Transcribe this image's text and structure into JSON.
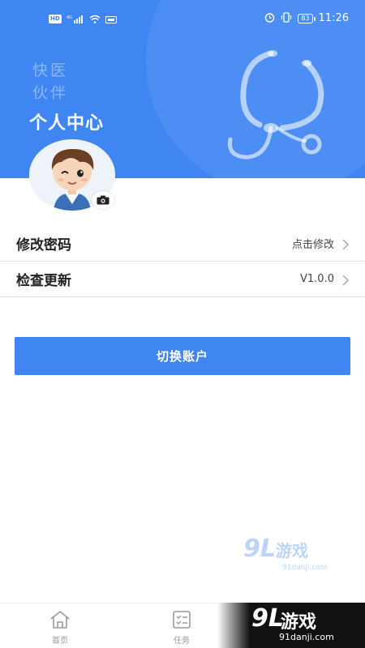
{
  "status_bar": {
    "hd": "HD",
    "network": "4G",
    "battery": "83",
    "time": "11:26"
  },
  "header": {
    "logo_line1": "快医",
    "logo_line2": "伙伴",
    "title": "个人中心",
    "background_color": "#3f86f3"
  },
  "settings": [
    {
      "label": "修改密码",
      "value": "点击修改"
    },
    {
      "label": "检查更新",
      "value": "V1.0.0"
    }
  ],
  "switch_account_label": "切换账户",
  "tab_bar": {
    "items": [
      {
        "label": "首页",
        "icon": "home-icon"
      },
      {
        "label": "任务",
        "icon": "task-list-icon"
      }
    ]
  },
  "watermark": {
    "number": "9L",
    "brand": "游戏",
    "site": "91danji.com"
  }
}
